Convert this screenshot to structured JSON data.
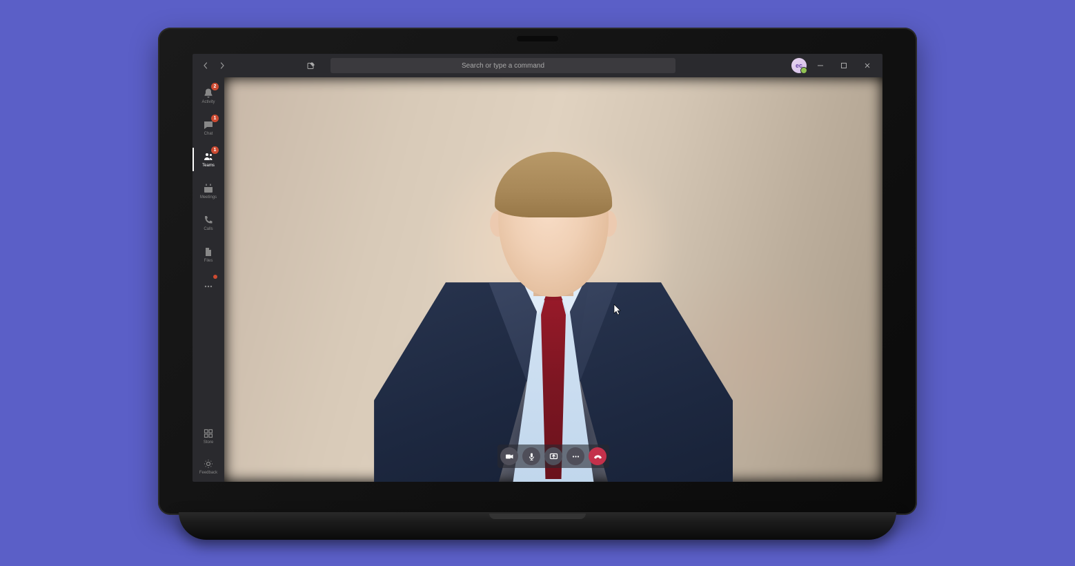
{
  "search": {
    "placeholder": "Search or type a command"
  },
  "avatar": {
    "initials": "ec"
  },
  "sidebar": {
    "items": [
      {
        "label": "Activity",
        "badge": "2"
      },
      {
        "label": "Chat",
        "badge": "1"
      },
      {
        "label": "Teams",
        "badge": "1"
      },
      {
        "label": "Meetings"
      },
      {
        "label": "Calls"
      },
      {
        "label": "Files"
      }
    ],
    "store": {
      "label": "Store"
    },
    "feedback": {
      "label": "Feedback"
    }
  },
  "colors": {
    "accent": "#5b5fc7",
    "hangup": "#c4314b",
    "badge": "#cc4a31",
    "presence": "#92c353"
  }
}
